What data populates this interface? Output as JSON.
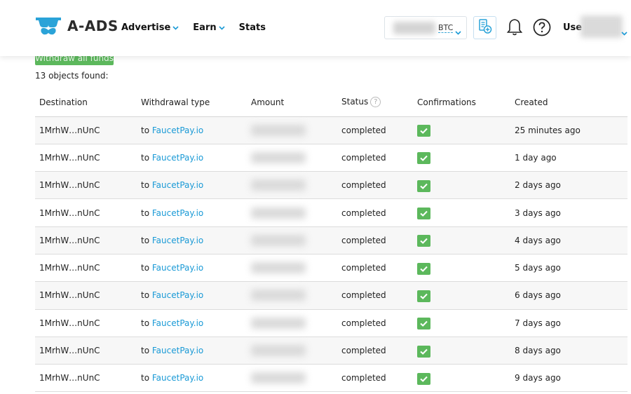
{
  "header": {
    "logo_text": "A-ADS",
    "nav": [
      {
        "label": "Advertise",
        "has_dropdown": true
      },
      {
        "label": "Earn",
        "has_dropdown": true
      },
      {
        "label": "Stats",
        "has_dropdown": false
      }
    ],
    "currency": "BTC",
    "user_label": "Use"
  },
  "withdraw_button_label": "Withdraw all funds",
  "objects_found": "13 objects found:",
  "table": {
    "columns": {
      "destination": "Destination",
      "type": "Withdrawal type",
      "amount": "Amount",
      "status": "Status",
      "confirmations": "Confirmations",
      "created": "Created"
    },
    "status_help": "?",
    "type_prefix": "to",
    "rows": [
      {
        "destination": "1MrhW…nUnC",
        "type": "FaucetPay.io",
        "status": "completed",
        "created": "25 minutes ago"
      },
      {
        "destination": "1MrhW…nUnC",
        "type": "FaucetPay.io",
        "status": "completed",
        "created": "1 day ago"
      },
      {
        "destination": "1MrhW…nUnC",
        "type": "FaucetPay.io",
        "status": "completed",
        "created": "2 days ago"
      },
      {
        "destination": "1MrhW…nUnC",
        "type": "FaucetPay.io",
        "status": "completed",
        "created": "3 days ago"
      },
      {
        "destination": "1MrhW…nUnC",
        "type": "FaucetPay.io",
        "status": "completed",
        "created": "4 days ago"
      },
      {
        "destination": "1MrhW…nUnC",
        "type": "FaucetPay.io",
        "status": "completed",
        "created": "5 days ago"
      },
      {
        "destination": "1MrhW…nUnC",
        "type": "FaucetPay.io",
        "status": "completed",
        "created": "6 days ago"
      },
      {
        "destination": "1MrhW…nUnC",
        "type": "FaucetPay.io",
        "status": "completed",
        "created": "7 days ago"
      },
      {
        "destination": "1MrhW…nUnC",
        "type": "FaucetPay.io",
        "status": "completed",
        "created": "8 days ago"
      },
      {
        "destination": "1MrhW…nUnC",
        "type": "FaucetPay.io",
        "status": "completed",
        "created": "9 days ago"
      }
    ]
  },
  "colors": {
    "accent_blue": "#1a9ad6",
    "success_green": "#5cb85c"
  },
  "icons": [
    "logo-glasses-icon",
    "chevron-down-icon",
    "wallet-add-icon",
    "bell-icon",
    "help-circle-icon",
    "check-icon"
  ]
}
